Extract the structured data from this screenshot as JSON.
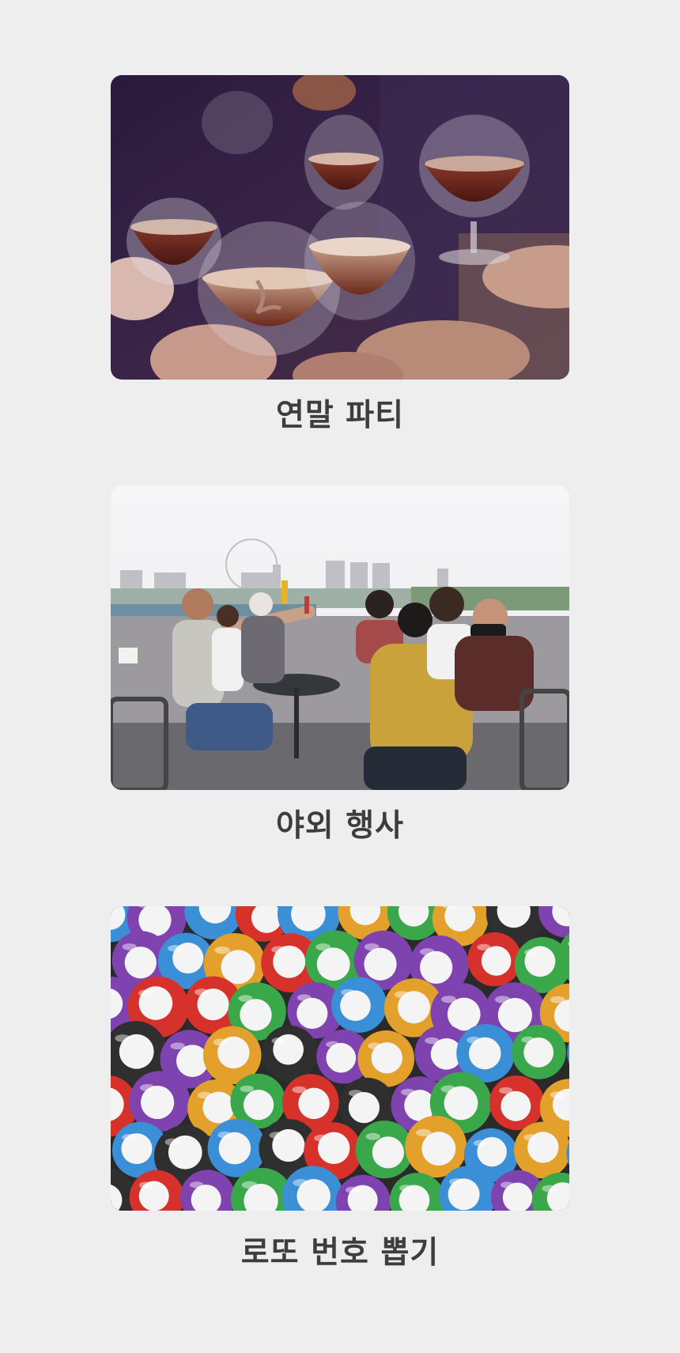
{
  "cards": [
    {
      "title": "연말 파티",
      "image": "wine-glasses-toast-photo"
    },
    {
      "title": "야외 행사",
      "image": "rooftop-friends-toast-photo"
    },
    {
      "title": "로또 번호 뽑기",
      "image": "lottery-balls-photo"
    }
  ],
  "colors": {
    "background": "#eeeeee",
    "caption_text": "#3d3d3d"
  }
}
